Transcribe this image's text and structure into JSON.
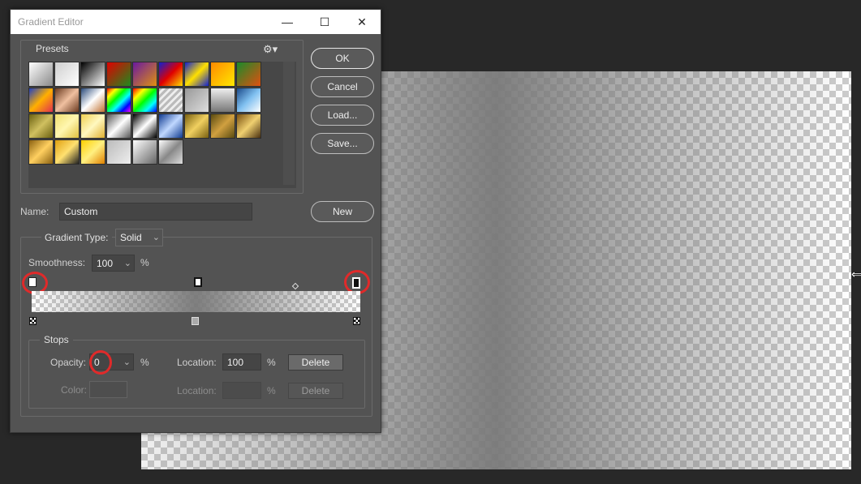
{
  "dialog": {
    "title": "Gradient Editor",
    "window_controls": {
      "minimize": "—",
      "maximize": "☐",
      "close": "✕"
    }
  },
  "presets": {
    "label": "Presets",
    "gear_icon": "gear-icon",
    "swatch_count": 33
  },
  "buttons": {
    "ok": "OK",
    "cancel": "Cancel",
    "load": "Load...",
    "save": "Save...",
    "new": "New"
  },
  "name_row": {
    "label": "Name:",
    "value": "Custom"
  },
  "gradient": {
    "type_label": "Gradient Type:",
    "type_value": "Solid",
    "smoothness_label": "Smoothness:",
    "smoothness_value": "100",
    "smoothness_unit": "%"
  },
  "stops": {
    "label": "Stops",
    "opacity_label": "Opacity:",
    "opacity_value": "0",
    "opacity_unit": "%",
    "opacity_location_label": "Location:",
    "opacity_location_value": "100",
    "opacity_location_unit": "%",
    "opacity_delete": "Delete",
    "color_label": "Color:",
    "color_location_label": "Location:",
    "color_location_value": "",
    "color_location_unit": "%",
    "color_delete": "Delete"
  },
  "colors": {
    "highlight": "#e02a2a",
    "dialog_bg": "#535353",
    "canvas_gray": "#787878"
  }
}
